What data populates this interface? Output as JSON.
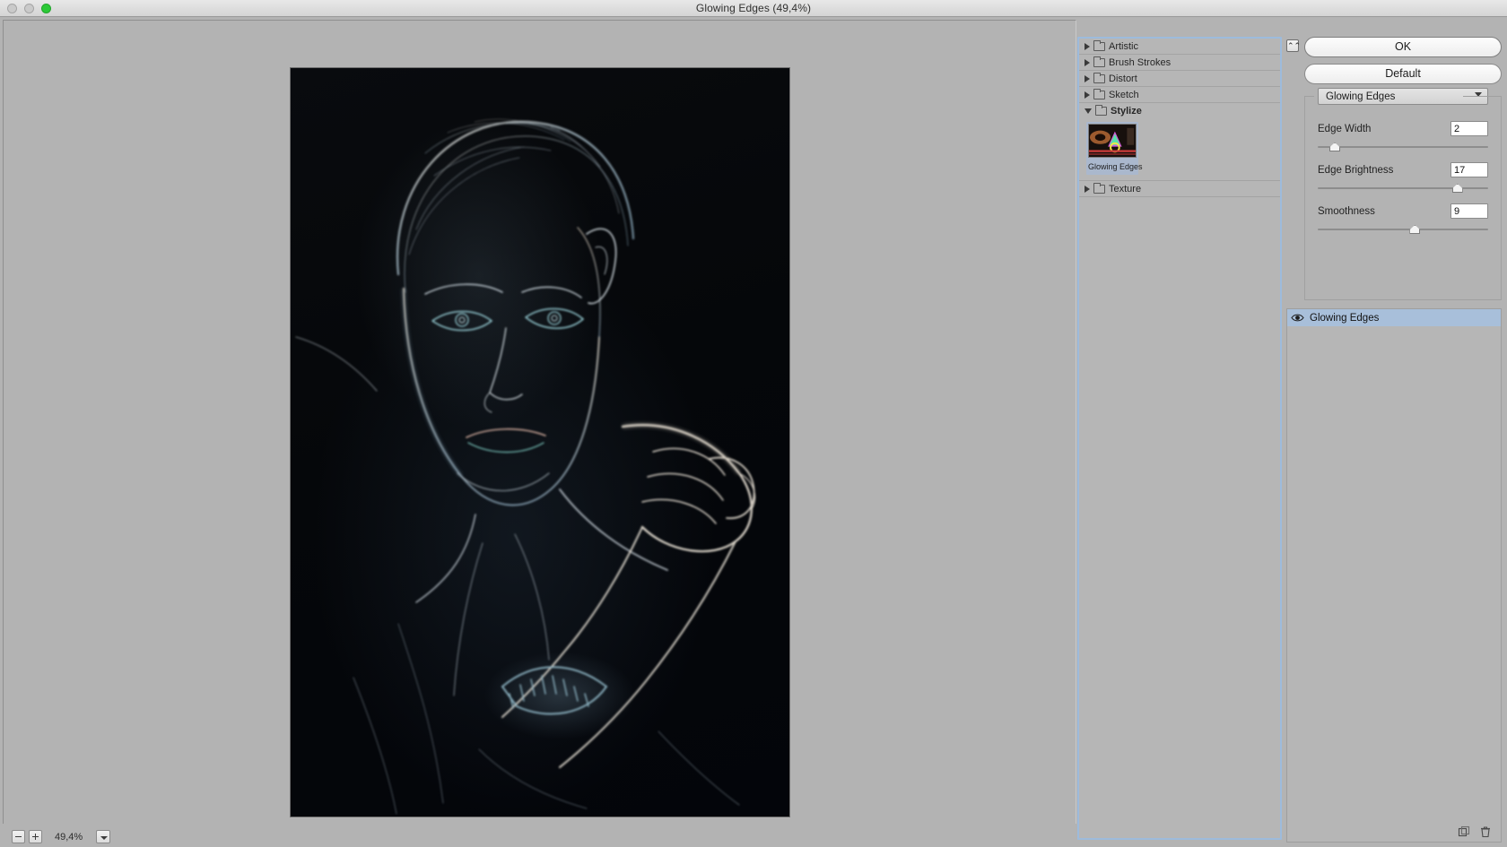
{
  "window": {
    "title": "Glowing Edges (49,4%)",
    "traffic_lights": [
      "close",
      "minimize",
      "maximize"
    ]
  },
  "preview": {
    "zoom_out_label": "−",
    "zoom_in_label": "+",
    "zoom_level": "49,4%",
    "zoom_dropdown_icon": "chevron-down-icon"
  },
  "filter_browser": {
    "categories": [
      {
        "name": "Artistic",
        "expanded": false,
        "icon": "folder-icon",
        "arrow": "triangle-right-icon"
      },
      {
        "name": "Brush Strokes",
        "expanded": false,
        "icon": "folder-icon",
        "arrow": "triangle-right-icon"
      },
      {
        "name": "Distort",
        "expanded": false,
        "icon": "folder-icon",
        "arrow": "triangle-right-icon"
      },
      {
        "name": "Sketch",
        "expanded": false,
        "icon": "folder-icon",
        "arrow": "triangle-right-icon"
      },
      {
        "name": "Stylize",
        "expanded": true,
        "icon": "folder-icon",
        "arrow": "triangle-down-icon"
      },
      {
        "name": "Texture",
        "expanded": false,
        "icon": "folder-icon",
        "arrow": "triangle-right-icon"
      }
    ],
    "stylize_filters": [
      {
        "name": "Glowing Edges",
        "selected": true
      }
    ]
  },
  "controls": {
    "collapse_icon": "collapse-panel-icon",
    "ok_label": "OK",
    "default_label": "Default"
  },
  "parameters": {
    "selected_filter": "Glowing Edges",
    "dropdown_icon": "chevron-down-icon",
    "items": [
      {
        "label": "Edge Width",
        "value": "2",
        "min": 1,
        "max": 14,
        "percent": 10
      },
      {
        "label": "Edge Brightness",
        "value": "17",
        "min": 0,
        "max": 20,
        "percent": 82
      },
      {
        "label": "Smoothness",
        "value": "9",
        "min": 1,
        "max": 15,
        "percent": 57
      }
    ]
  },
  "effects_panel": {
    "rows": [
      {
        "label": "Glowing Edges",
        "visible": true,
        "selected": true,
        "eye_icon": "eye-icon"
      }
    ],
    "new_effect_icon": "new-effect-layer-icon",
    "delete_icon": "trash-icon"
  },
  "colors": {
    "chrome": "#b3b3b3",
    "selection": "#a8bfda",
    "focus_border": "#9dbbdc",
    "maximize_green": "#2bc937"
  }
}
